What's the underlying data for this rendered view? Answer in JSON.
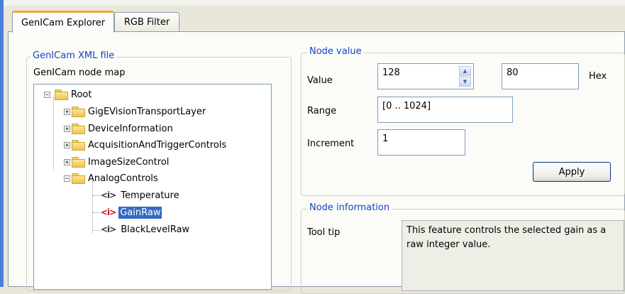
{
  "tabs": [
    {
      "label": "GenICam Explorer",
      "active": true
    },
    {
      "label": "RGB Filter",
      "active": false
    }
  ],
  "xml_group": {
    "legend": "GenICam XML file",
    "node_map_label": "GenICam node map"
  },
  "tree": {
    "root": "Root",
    "categories": [
      "GigEVisionTransportLayer",
      "DeviceInformation",
      "AcquisitionAndTriggerControls",
      "ImageSizeControl",
      "AnalogControls"
    ],
    "features": [
      "Temperature",
      "GainRaw",
      "BlackLevelRaw"
    ],
    "selected": "GainRaw",
    "expander_plus": "+",
    "expander_minus": "−",
    "feature_icon": "<i>"
  },
  "node_value": {
    "legend": "Node value",
    "value_label": "Value",
    "value": "128",
    "hex_value": "80",
    "hex_label": "Hex",
    "range_label": "Range",
    "range": "[0 .. 1024]",
    "increment_label": "Increment",
    "increment": "1",
    "apply_label": "Apply"
  },
  "node_info": {
    "legend": "Node information",
    "tooltip_label": "Tool tip",
    "tooltip_text": "This feature controls the selected gain as a raw integer value."
  },
  "colors": {
    "legend_text": "#1645c5",
    "selection": "#316ac5",
    "tab_highlight": "#f2a33a",
    "window_edge": "#4a7fd8"
  },
  "icons": {
    "folder": "folder-icon",
    "feature": "integer-feature-icon",
    "spin_up": "spin-up-icon",
    "spin_down": "spin-down-icon"
  }
}
